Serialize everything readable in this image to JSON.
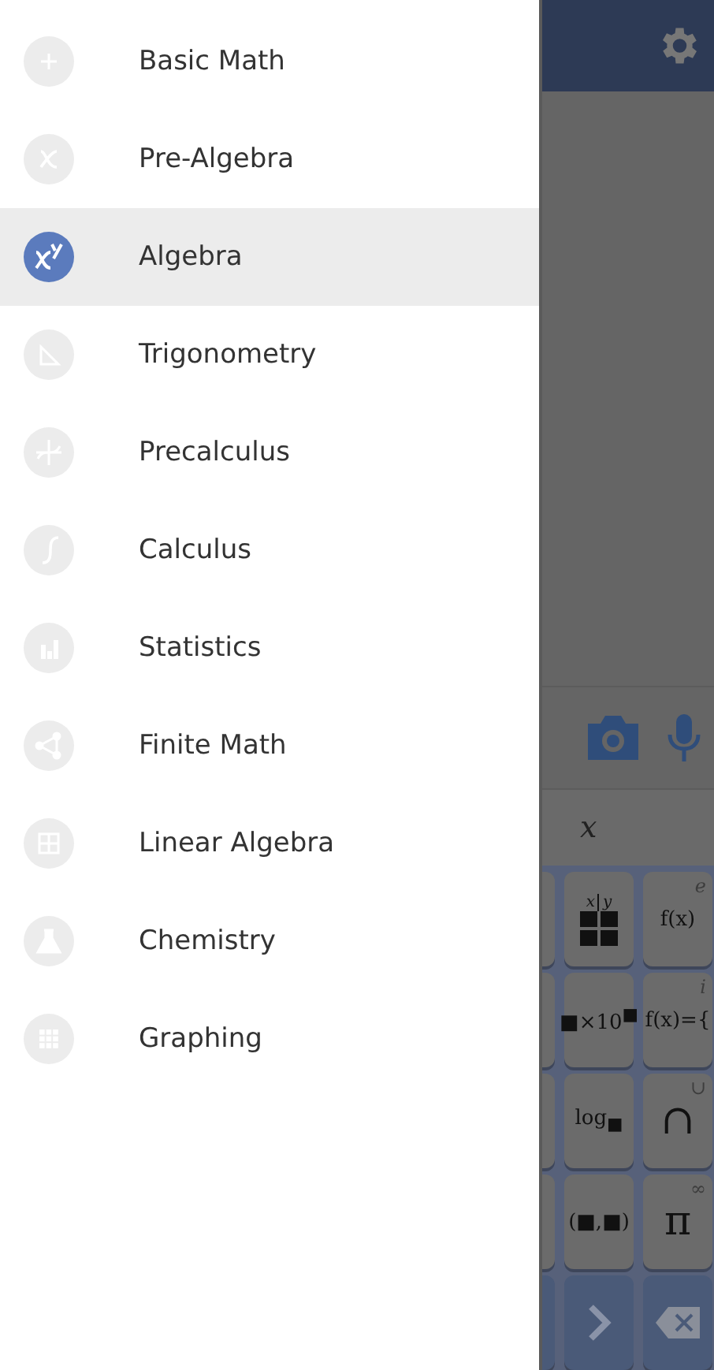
{
  "drawer": {
    "items": [
      {
        "label": "Basic Math",
        "selected": false
      },
      {
        "label": "Pre-Algebra",
        "selected": false
      },
      {
        "label": "Algebra",
        "selected": true
      },
      {
        "label": "Trigonometry",
        "selected": false
      },
      {
        "label": "Precalculus",
        "selected": false
      },
      {
        "label": "Calculus",
        "selected": false
      },
      {
        "label": "Statistics",
        "selected": false
      },
      {
        "label": "Finite Math",
        "selected": false
      },
      {
        "label": "Linear Algebra",
        "selected": false
      },
      {
        "label": "Chemistry",
        "selected": false
      },
      {
        "label": "Graphing",
        "selected": false
      }
    ]
  },
  "input_bar": {
    "variable": "x"
  },
  "keyboard": {
    "rows": [
      [
        {
          "kind": "table",
          "headers": [
            "x",
            "y"
          ]
        },
        {
          "kind": "text",
          "text": "f(x)",
          "corner": "e"
        }
      ],
      [
        {
          "kind": "text",
          "text": "■×10$^{■}$"
        },
        {
          "kind": "text",
          "text": "f(x)={",
          "corner": "i"
        }
      ],
      [
        {
          "kind": "text",
          "text": "log$_{■}$"
        },
        {
          "kind": "text",
          "text": "∩",
          "corner": "∪"
        }
      ],
      [
        {
          "kind": "text",
          "text": "(■,■)"
        },
        {
          "kind": "text",
          "text": "π",
          "corner": "∞"
        }
      ],
      [
        {
          "kind": "next"
        },
        {
          "kind": "backspace"
        }
      ]
    ]
  }
}
